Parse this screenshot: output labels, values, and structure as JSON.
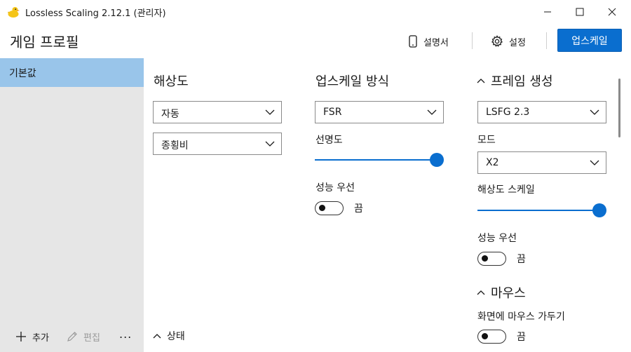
{
  "window": {
    "title": "Lossless Scaling 2.12.1 (관리자)"
  },
  "header": {
    "title": "게임 프로필",
    "manual_label": "설명서",
    "settings_label": "설정",
    "upscale_label": "업스케일"
  },
  "sidebar": {
    "items": [
      {
        "label": "기본값"
      }
    ],
    "add_label": "추가",
    "edit_label": "편집",
    "more_label": "..."
  },
  "resolution": {
    "heading": "해상도",
    "mode_value": "자동",
    "aspect_value": "종횡비",
    "status_label": "상태"
  },
  "upscaling": {
    "heading": "업스케일 방식",
    "method_value": "FSR",
    "sharpness_label": "선명도",
    "sharpness_level": 1.0,
    "performance_label": "성능 우선",
    "performance_state": "끔"
  },
  "frame_gen": {
    "heading": "프레임 생성",
    "type_value": "LSFG 2.3",
    "mode_label": "모드",
    "mode_value": "X2",
    "res_scale_label": "해상도 스케일",
    "res_scale_level": 1.0,
    "performance_label": "성능 우선",
    "performance_state": "끔"
  },
  "mouse": {
    "heading": "마우스",
    "hide_cursor_label": "화면에 마우스 가두기",
    "hide_cursor_state": "끔"
  },
  "colors": {
    "accent": "#0a6ecf",
    "selection": "#99c5ea",
    "sidebar_bg": "#e6e6e6"
  }
}
